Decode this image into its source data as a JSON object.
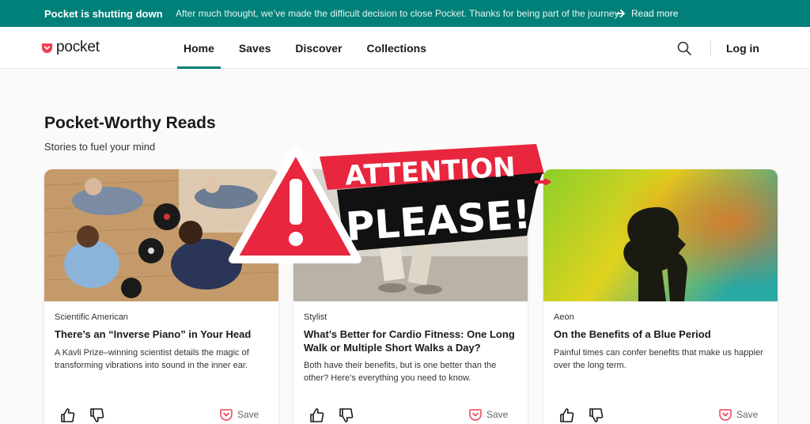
{
  "banner": {
    "title": "Pocket is shutting down",
    "message": "After much thought, we’ve made the difficult decision to close Pocket. Thanks for being part of the journey.",
    "link_label": "Read more"
  },
  "header": {
    "logo_text": "pocket",
    "nav": [
      {
        "label": "Home",
        "active": true
      },
      {
        "label": "Saves",
        "active": false
      },
      {
        "label": "Discover",
        "active": false
      },
      {
        "label": "Collections",
        "active": false
      }
    ],
    "login_label": "Log in"
  },
  "section": {
    "title": "Pocket-Worthy Reads",
    "subtitle": "Stories to fuel your mind"
  },
  "cards": [
    {
      "publisher": "Scientific American",
      "title": "There’s an “Inverse Piano” in Your Head",
      "excerpt": "A Kavli Prize–winning scientist details the magic of transforming vibrations into sound in the inner ear.",
      "save_label": "Save"
    },
    {
      "publisher": "Stylist",
      "title": "What’s Better for Cardio Fitness: One Long Walk or Multiple Short Walks a Day?",
      "excerpt": "Both have their benefits, but is one better than the other? Here’s everything you need to know.",
      "save_label": "Save"
    },
    {
      "publisher": "Aeon",
      "title": "On the Benefits of a Blue Period",
      "excerpt": "Painful times can confer benefits that make us happier over the long term.",
      "save_label": "Save"
    }
  ],
  "overlay": {
    "line1": "ATTENTION",
    "line2": "PLEASE!"
  },
  "colors": {
    "brand_teal": "#008078",
    "pocket_red": "#ef4056",
    "alert_red": "#e8263e"
  }
}
